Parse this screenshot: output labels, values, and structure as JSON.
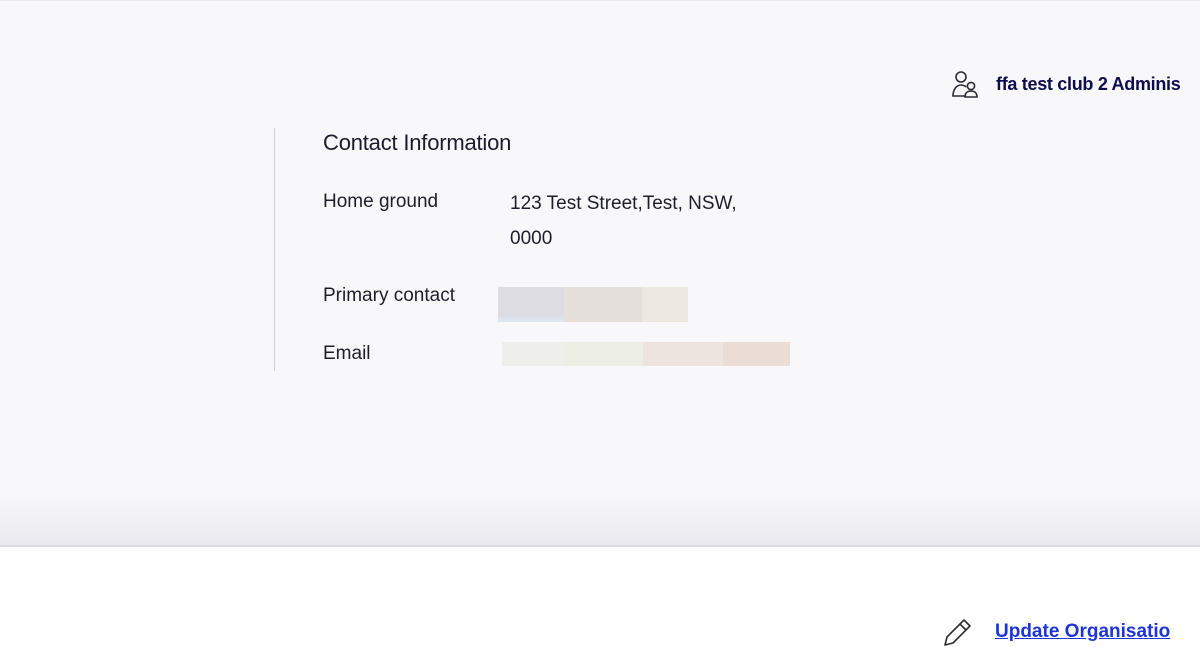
{
  "header": {
    "user_icon": "user-group-icon",
    "user_name": "ffa test club 2 Adminis"
  },
  "contact_info": {
    "title": "Contact Information",
    "fields": [
      {
        "label": "Home ground",
        "value_line1": "123 Test Street,Test, NSW,",
        "value_line2": "0000"
      },
      {
        "label": "Primary contact",
        "value": ""
      },
      {
        "label": "Email",
        "value": ""
      }
    ]
  },
  "footer": {
    "edit_icon": "pencil-icon",
    "update_label": "Update Organisatio"
  },
  "colors": {
    "panel_bg": "#f8f8fb",
    "user_name": "#0d0d4d",
    "link": "#1d35d6"
  }
}
